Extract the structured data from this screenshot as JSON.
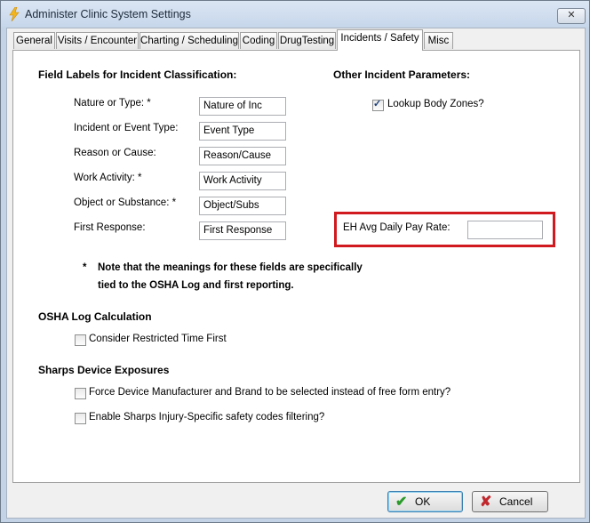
{
  "window": {
    "title": "Administer Clinic System Settings",
    "close_glyph": "✕",
    "app_icon": "lightning-bolt-icon"
  },
  "tabs": [
    {
      "label": "General",
      "active": false
    },
    {
      "label": "Visits / Encounter",
      "active": false
    },
    {
      "label": "Charting / Scheduling",
      "active": false
    },
    {
      "label": "Coding",
      "active": false
    },
    {
      "label": "DrugTesting",
      "active": false
    },
    {
      "label": "Incidents / Safety",
      "active": true
    },
    {
      "label": "Misc",
      "active": false
    }
  ],
  "field_labels": {
    "heading": "Field Labels for Incident Classification:",
    "rows": [
      {
        "label": "Nature or Type:  *",
        "value": "Nature of Inc"
      },
      {
        "label": "Incident or Event Type:",
        "value": "Event Type"
      },
      {
        "label": "Reason or Cause:",
        "value": "Reason/Cause"
      },
      {
        "label": "Work Activity:  *",
        "value": "Work Activity"
      },
      {
        "label": "Object or Substance: *",
        "value": "Object/Subs"
      },
      {
        "label": "First Response:",
        "value": "First Response"
      }
    ],
    "note_star": "*",
    "note_line1": "Note that the meanings for these fields are specifically",
    "note_line2": "tied to the OSHA Log and first reporting."
  },
  "other_params": {
    "heading": "Other Incident Parameters:",
    "lookup_body_zones": {
      "label": "Lookup Body Zones?",
      "checked": true,
      "check_glyph": "✓"
    },
    "eh_avg_daily_pay_rate": {
      "label": "EH Avg Daily Pay Rate:",
      "value": ""
    },
    "highlight_color": "#d11a1f"
  },
  "osha": {
    "heading": "OSHA Log Calculation",
    "consider_restricted": {
      "label": "Consider Restricted Time First",
      "checked": false
    }
  },
  "sharps": {
    "heading": "Sharps Device Exposures",
    "force_device": {
      "label": "Force Device Manufacturer and Brand to be selected instead of free form entry?",
      "checked": false
    },
    "enable_filtering": {
      "label": "Enable Sharps Injury-Specific safety codes filtering?",
      "checked": false
    }
  },
  "buttons": {
    "ok": {
      "label": "OK",
      "icon": "green-checkmark-icon",
      "glyph": "✔",
      "color": "#2a9a2a"
    },
    "cancel": {
      "label": "Cancel",
      "icon": "red-x-icon",
      "glyph": "✘",
      "color": "#c0282d"
    }
  }
}
